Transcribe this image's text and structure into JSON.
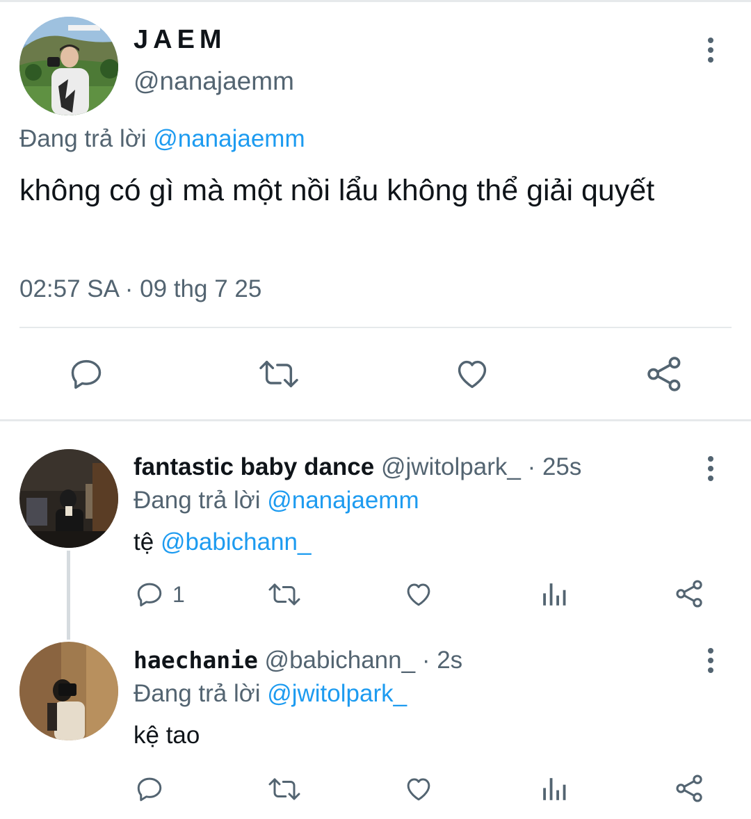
{
  "colors": {
    "link": "#1d9bf0",
    "muted": "#536471",
    "text": "#0f1419",
    "divider": "#e6e9eb"
  },
  "main_tweet": {
    "display_name": "JAEM",
    "handle": "@nanajaemm",
    "replying_prefix": "Đang trả lời",
    "replying_to": "@nanajaemm",
    "text": "không có gì mà một nồi lẩu không thể giải quyết",
    "timestamp": "02:57 SA · 09 thg 7 25",
    "actions": [
      "reply-icon",
      "retweet-icon",
      "like-icon",
      "share-icon"
    ]
  },
  "replies": [
    {
      "display_name": "fantastic baby dance",
      "handle": "@jwitolpark_",
      "time": "· 25s",
      "replying_prefix": "Đang trả lời",
      "replying_to": "@nanajaemm",
      "text_prefix": "tệ",
      "text_mention": "@babichann_",
      "reply_count": "1"
    },
    {
      "display_name": "haechanie",
      "handle": "@babichann_",
      "time": "· 2s",
      "replying_prefix": "Đang trả lời",
      "replying_to": "@jwitolpark_",
      "text": "kệ tao",
      "reply_count": ""
    }
  ]
}
